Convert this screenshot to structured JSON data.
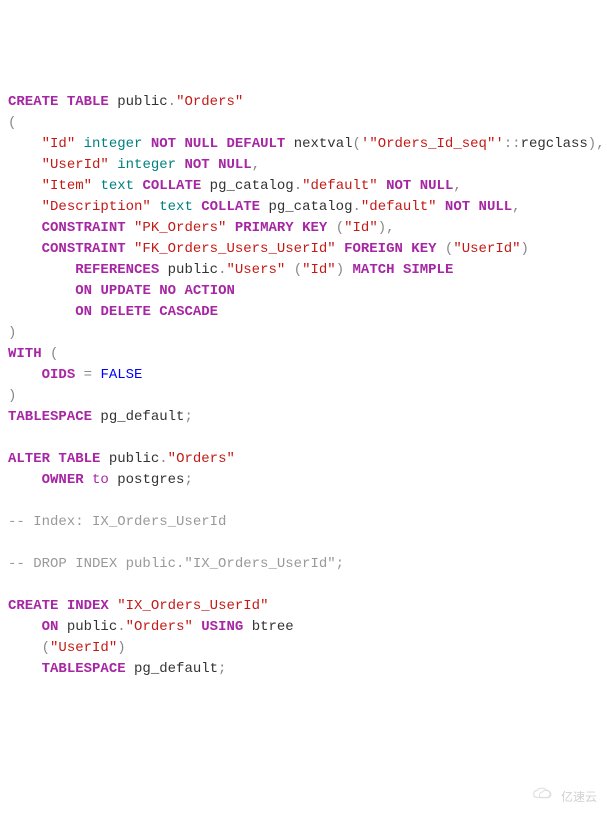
{
  "code": {
    "l1": {
      "create": "CREATE",
      "table": "TABLE",
      "public": "public",
      "dot": ".",
      "orders": "\"Orders\""
    },
    "l2": {
      "paren": "("
    },
    "l3": {
      "id": "\"Id\"",
      "integer": "integer",
      "not": "NOT",
      "null": "NULL",
      "default": "DEFAULT",
      "nextval": "nextval",
      "po": "(",
      "seq": "'\"Orders_Id_seq\"'",
      "cast": "::",
      "regclass": "regclass",
      "pc": ")",
      "comma": ","
    },
    "l4": {
      "userid": "\"UserId\"",
      "integer": "integer",
      "not": "NOT",
      "null": "NULL",
      "comma": ","
    },
    "l5": {
      "item": "\"Item\"",
      "text_t": "text",
      "collate": "COLLATE",
      "pg": "pg_catalog",
      "dot": ".",
      "def": "\"default\"",
      "not": "NOT",
      "null": "NULL",
      "comma": ","
    },
    "l6": {
      "desc": "\"Description\"",
      "text_t": "text",
      "collate": "COLLATE",
      "pg": "pg_catalog",
      "dot": ".",
      "def": "\"default\"",
      "not": "NOT",
      "null": "NULL",
      "comma": ","
    },
    "l7": {
      "constraint": "CONSTRAINT",
      "pk": "\"PK_Orders\"",
      "primary": "PRIMARY",
      "key": "KEY",
      "po": "(",
      "id": "\"Id\"",
      "pc": ")",
      "comma": ","
    },
    "l8": {
      "constraint": "CONSTRAINT",
      "fk": "\"FK_Orders_Users_UserId\"",
      "foreign": "FOREIGN",
      "key": "KEY",
      "po": "(",
      "userid": "\"UserId\"",
      "pc": ")"
    },
    "l9": {
      "references": "REFERENCES",
      "public": "public",
      "dot": ".",
      "users": "\"Users\"",
      "po": "(",
      "id": "\"Id\"",
      "pc": ")",
      "match": "MATCH",
      "simple": "SIMPLE"
    },
    "l10": {
      "on": "ON",
      "update": "UPDATE",
      "no": "NO",
      "action": "ACTION"
    },
    "l11": {
      "on": "ON",
      "delete": "DELETE",
      "cascade": "CASCADE"
    },
    "l12": {
      "pc": ")"
    },
    "l13": {
      "with": "WITH",
      "po": "("
    },
    "l14": {
      "oids": "OIDS",
      "eq": "=",
      "false": "FALSE"
    },
    "l15": {
      "pc": ")"
    },
    "l16": {
      "tablespace": "TABLESPACE",
      "pg_default": "pg_default",
      "semi": ";"
    },
    "l18": {
      "alter": "ALTER",
      "table": "TABLE",
      "public": "public",
      "dot": ".",
      "orders": "\"Orders\""
    },
    "l19": {
      "owner": "OWNER",
      "to": "to",
      "postgres": "postgres",
      "semi": ";"
    },
    "l21": {
      "comment": "-- Index: IX_Orders_UserId"
    },
    "l23": {
      "comment": "-- DROP INDEX public.\"IX_Orders_UserId\";"
    },
    "l25": {
      "create": "CREATE",
      "index": "INDEX",
      "ix": "\"IX_Orders_UserId\""
    },
    "l26": {
      "on": "ON",
      "public": "public",
      "dot": ".",
      "orders": "\"Orders\"",
      "using": "USING",
      "btree": "btree"
    },
    "l27": {
      "po": "(",
      "userid": "\"UserId\"",
      "pc": ")"
    },
    "l28": {
      "tablespace": "TABLESPACE",
      "pg_default": "pg_default",
      "semi": ";"
    }
  },
  "watermark": {
    "text": "亿速云"
  }
}
